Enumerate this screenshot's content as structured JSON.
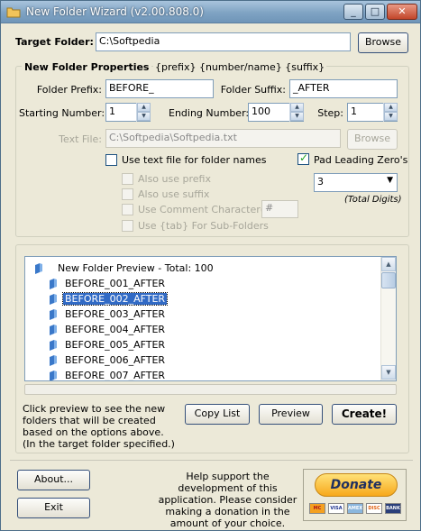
{
  "window": {
    "title": "New Folder Wizard  (v2.00.808.0)",
    "controls": {
      "minimize": "_",
      "maximize": "□",
      "close": "✕"
    }
  },
  "target": {
    "label": "Target Folder:",
    "value": "C:\\Softpedia",
    "browse_label": "Browse"
  },
  "properties": {
    "heading": "New Folder Properties",
    "pattern": "{prefix} {number/name} {suffix}",
    "prefix_label": "Folder Prefix:",
    "prefix_value": "BEFORE_",
    "suffix_label": "Folder Suffix:",
    "suffix_value": "_AFTER",
    "start_label": "Starting Number:",
    "start_value": "1",
    "end_label": "Ending Number:",
    "end_value": "100",
    "step_label": "Step:",
    "step_value": "1",
    "textfile_label": "Text File:",
    "textfile_value": "C:\\Softpedia\\Softpedia.txt",
    "textfile_browse": "Browse",
    "use_textfile_label": "Use text file for folder names",
    "use_textfile_checked": false,
    "pad_label": "Pad Leading Zero's",
    "pad_checked": true,
    "pad_digits": "3",
    "pad_hint": "(Total Digits)",
    "also_prefix_label": "Also use prefix",
    "also_suffix_label": "Also use suffix",
    "comment_label": "Use Comment Character(s):",
    "comment_value": "#",
    "tab_label": "Use {tab} For Sub-Folders"
  },
  "preview": {
    "root_label": "New Folder Preview - Total: 100",
    "items": [
      "BEFORE_001_AFTER",
      "BEFORE_002_AFTER",
      "BEFORE_003_AFTER",
      "BEFORE_004_AFTER",
      "BEFORE_005_AFTER",
      "BEFORE_006_AFTER",
      "BEFORE_007_AFTER"
    ],
    "selected_index": 1,
    "progress": 0
  },
  "actions": {
    "hint": "Click preview to see the new folders that will be created based on the options above. (In the target folder specified.)",
    "copy_list": "Copy List",
    "preview": "Preview",
    "create": "Create!"
  },
  "footer": {
    "about": "About...",
    "exit": "Exit",
    "support_text": "Help support the development of this application. Please consider making a donation in the amount of your choice.",
    "donate": "Donate",
    "cards": [
      "MC",
      "VISA",
      "AMEX",
      "DISC",
      "BANK"
    ]
  },
  "colors": {
    "accent": "#316ac5",
    "title": "#7fa3c3",
    "donate": "#f7a81b"
  },
  "icons": [
    "folder-icon",
    "app-icon",
    "check-icon",
    "spin-up-icon",
    "spin-down-icon",
    "dropdown-arrow-icon"
  ]
}
